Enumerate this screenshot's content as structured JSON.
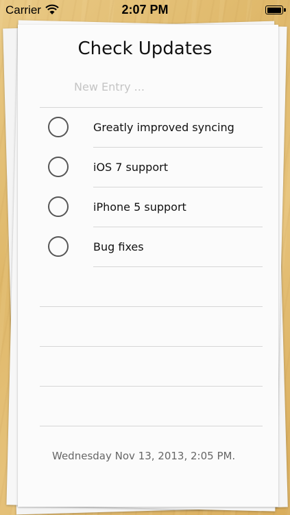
{
  "status_bar": {
    "carrier": "Carrier",
    "time": "2:07 PM",
    "battery_level": 1.0
  },
  "note": {
    "title": "Check Updates",
    "new_entry_placeholder": "New Entry ...",
    "items": [
      {
        "label": "Greatly improved syncing",
        "checked": false
      },
      {
        "label": "iOS 7 support",
        "checked": false
      },
      {
        "label": "iPhone 5 support",
        "checked": false
      },
      {
        "label": "Bug fixes",
        "checked": false
      }
    ],
    "date": "Wednesday Nov 13, 2013, 2:05 PM."
  },
  "icons": {
    "wifi": "wifi-icon",
    "battery": "battery-icon",
    "checkbox": "circle-checkbox-icon"
  },
  "colors": {
    "paper": "#fbfbfb",
    "rule": "#d6d6d6",
    "placeholder": "#c4c4c4",
    "checkbox_border": "#555555"
  }
}
